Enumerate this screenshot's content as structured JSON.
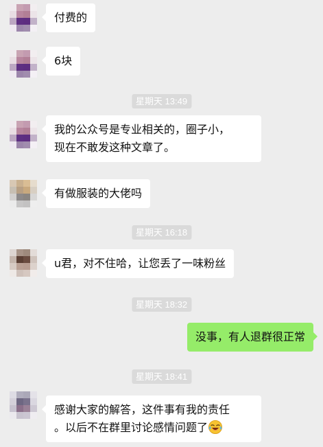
{
  "messages": [
    {
      "type": "text",
      "side": "left",
      "text": "付费的"
    },
    {
      "type": "text",
      "side": "left",
      "text": "6块"
    },
    {
      "type": "time",
      "text": "星期天 13:49"
    },
    {
      "type": "text",
      "side": "left",
      "lines": [
        "我的公众号是专业相关的，圈子小，",
        "现在不敢发这种文章了。"
      ]
    },
    {
      "type": "text",
      "side": "left",
      "text": "有做服装的大佬吗"
    },
    {
      "type": "time",
      "text": "星期天 16:18"
    },
    {
      "type": "text",
      "side": "left",
      "text": "u君，对不住哈，让您丢了一味粉丝"
    },
    {
      "type": "time",
      "text": "星期天 18:32"
    },
    {
      "type": "text",
      "side": "right",
      "text": "没事，有人退群很正常"
    },
    {
      "type": "time",
      "text": "星期天 18:41"
    },
    {
      "type": "text",
      "side": "left",
      "lines": [
        "感谢大家的解答，这件事有我的责任",
        "。以后不在群里讨论感情问题了"
      ],
      "emoji": "crying-laughing-emoji"
    }
  ],
  "colors": {
    "background": "#ededed",
    "bubble_left": "#ffffff",
    "bubble_right": "#95ec69",
    "timestamp_bg": "#dadada",
    "timestamp_text": "#ffffff"
  }
}
